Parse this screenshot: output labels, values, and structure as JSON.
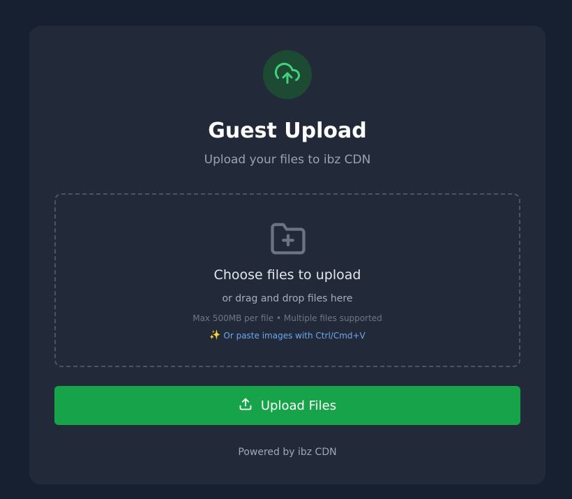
{
  "header": {
    "title": "Guest Upload",
    "subtitle": "Upload your files to ibz CDN",
    "icon": "cloud-upload-icon"
  },
  "dropzone": {
    "icon": "folder-plus-icon",
    "title": "Choose files to upload",
    "subtitle": "or drag and drop files here",
    "limits": "Max 500MB per file • Multiple files supported",
    "paste_icon": "sparkles-icon",
    "paste_hint": "Or paste images with Ctrl/Cmd+V"
  },
  "upload_button": {
    "label": "Upload Files",
    "icon": "upload-icon"
  },
  "footer": {
    "text": "Powered by ibz CDN"
  },
  "colors": {
    "background": "#172030",
    "card": "#222a3a",
    "accent": "#17a34a",
    "badge": "#1d4a33",
    "badge_icon": "#3fd47a",
    "link": "#6fa6ee"
  }
}
